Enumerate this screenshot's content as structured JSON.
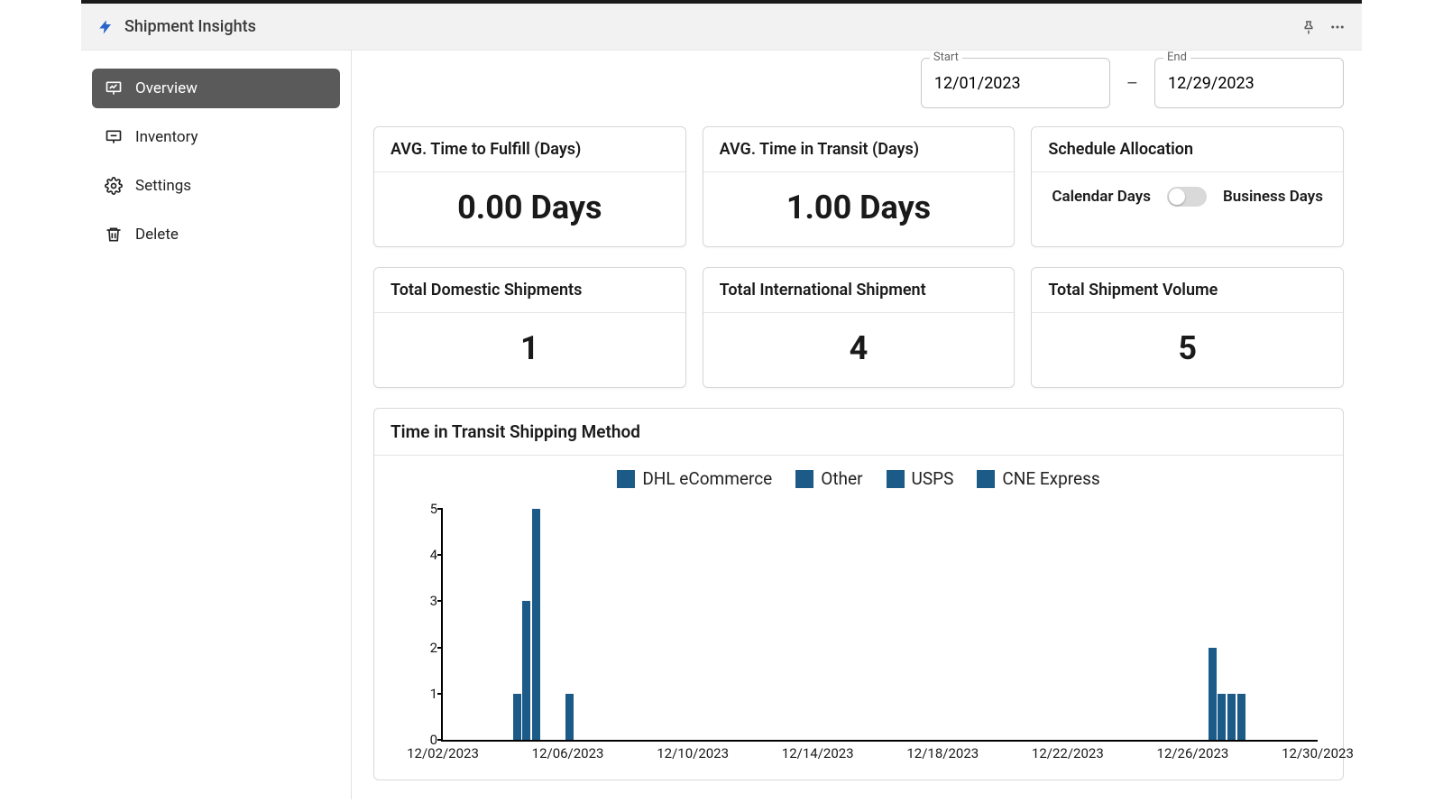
{
  "app": {
    "title": "Shipment Insights"
  },
  "sidebar": {
    "items": [
      {
        "label": "Overview",
        "active": true
      },
      {
        "label": "Inventory",
        "active": false
      },
      {
        "label": "Settings",
        "active": false
      },
      {
        "label": "Delete",
        "active": false
      }
    ]
  },
  "dates": {
    "start_label": "Start",
    "start_value": "12/01/2023",
    "end_label": "End",
    "end_value": "12/29/2023",
    "separator": "–"
  },
  "stat_cards": {
    "fulfill": {
      "label": "AVG. Time to Fulfill (Days)",
      "value": "0.00 Days"
    },
    "transit": {
      "label": "AVG. Time in Transit (Days)",
      "value": "1.00 Days"
    },
    "schedule": {
      "label": "Schedule Allocation",
      "left": "Calendar Days",
      "right": "Business Days"
    },
    "domestic": {
      "label": "Total Domestic Shipments",
      "value": "1"
    },
    "international": {
      "label": "Total International Shipment",
      "value": "4"
    },
    "volume": {
      "label": "Total Shipment Volume",
      "value": "5"
    }
  },
  "chart": {
    "title": "Time in Transit Shipping Method",
    "legend": [
      "DHL eCommerce",
      "Other",
      "USPS",
      "CNE Express"
    ]
  },
  "chart_data": {
    "type": "bar",
    "ylim": [
      0,
      5
    ],
    "yticks": [
      0,
      1,
      2,
      3,
      4,
      5
    ],
    "xlabels": [
      "12/02/2023",
      "12/06/2023",
      "12/10/2023",
      "12/14/2023",
      "12/18/2023",
      "12/22/2023",
      "12/26/2023",
      "12/30/2023"
    ],
    "series": [
      {
        "name": "DHL eCommerce"
      },
      {
        "name": "Other"
      },
      {
        "name": "USPS"
      },
      {
        "name": "CNE Express"
      }
    ],
    "bars": [
      {
        "x_pct": 8.0,
        "value": 1
      },
      {
        "x_pct": 9.1,
        "value": 3
      },
      {
        "x_pct": 10.2,
        "value": 5
      },
      {
        "x_pct": 14.0,
        "value": 1
      },
      {
        "x_pct": 87.5,
        "value": 2
      },
      {
        "x_pct": 88.6,
        "value": 1
      },
      {
        "x_pct": 89.7,
        "value": 1
      },
      {
        "x_pct": 90.8,
        "value": 1
      }
    ]
  }
}
